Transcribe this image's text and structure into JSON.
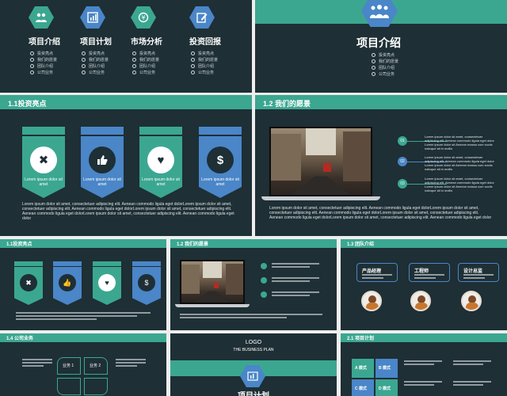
{
  "slide1": {
    "columns": [
      {
        "title": "项目介绍",
        "items": [
          "投资亮点",
          "我们的愿景",
          "团队介绍",
          "公司业务"
        ],
        "color": "#3ba791"
      },
      {
        "title": "项目计划",
        "items": [
          "投资亮点",
          "我们的愿景",
          "团队介绍",
          "公司业务"
        ],
        "color": "#4a86c8"
      },
      {
        "title": "市场分析",
        "items": [
          "投资亮点",
          "我们的愿景",
          "团队介绍",
          "公司业务"
        ],
        "color": "#3ba791"
      },
      {
        "title": "投资回报",
        "items": [
          "投资亮点",
          "我们的愿景",
          "团队介绍",
          "公司业务"
        ],
        "color": "#4a86c8"
      }
    ]
  },
  "slide2": {
    "title": "项目介绍",
    "items": [
      "投资亮点",
      "我们的愿景",
      "团队介绍",
      "公司业务"
    ]
  },
  "slide3": {
    "title": "1.1投资亮点",
    "badges": [
      {
        "icon": "tools-icon",
        "glyph": "✖",
        "caption": "Lorem ipsum dolor sit amet",
        "color": "#3ba791"
      },
      {
        "icon": "thumbs-up-icon",
        "glyph": "👍",
        "caption": "Lorem ipsum dolor sit amet",
        "color": "#4a86c8"
      },
      {
        "icon": "heart-icon",
        "glyph": "♥",
        "caption": "Lorem ipsum dolor sit amet",
        "color": "#3ba791"
      },
      {
        "icon": "dollar-icon",
        "glyph": "$",
        "caption": "Lorem ipsum dolor sit amet",
        "color": "#4a86c8"
      }
    ],
    "paragraph": "Lorem ipsum dolor sit amet, consectetuer adipiscing elit. Aenean commodo ligula eget dolorLorem ipsum dolor sit amet, consectetuer adipiscing elit. Aenean commodo ligula eget dolorLorem ipsum dolor sit amet, consectetuer adipiscing elit. Aenean commodo ligula eget dolorLorem ipsum dolor sit amet, consectetuer adipiscing elit. Aenean commodo ligula eget dolor"
  },
  "slide4": {
    "title": "1.2 我们的愿景",
    "points": [
      {
        "num": "01",
        "text": "Lorem ipsum dolor sit amet, consectetuer adipiscing elit. Aenean commodo ligula eget dolor Lorem ipsum dolor sit Aenean massa cum sociis natoque sit in mollis"
      },
      {
        "num": "02",
        "text": "Lorem ipsum dolor sit amet, consectetuer adipiscing elit. Aenean commodo ligula eget dolor Lorem ipsum dolor sit Aenean massa cum sociis natoque sit in mollis"
      },
      {
        "num": "03",
        "text": "Lorem ipsum dolor sit amet, consectetuer adipiscing elit. Aenean commodo ligula eget dolor Lorem ipsum dolor sit Aenean massa cum sociis natoque sit in mollis"
      }
    ],
    "paragraph": "Lorem ipsum dolor sit amet, consectetuer adipiscing elit. Aenean commodo ligula eget dolorLorem ipsum dolor sit amet, consectetuer adipiscing elit. Aenean commodo ligula eget dolorLorem ipsum dolor sit amet, consectetuer adipiscing elit. Aenean commodo ligula eget dolorLorem ipsum dolor sit amet, consectetuer adipiscing elit. Aenean commodo ligula eget dolor"
  },
  "slide5": {
    "title": "1.1投资亮点"
  },
  "slide6": {
    "title": "1.2 我们的愿景"
  },
  "slide7": {
    "title": "1.3 团队介绍",
    "boxes": [
      "产品经理",
      "工程师",
      "设计总监"
    ]
  },
  "slide8": {
    "title": "1.4 公司业务",
    "quads": [
      "业务 1",
      "业务 2"
    ]
  },
  "slide9": {
    "logo": "LOGO",
    "subtitle": "THE BUSINESS PLAN",
    "title": "项目计划"
  },
  "slide10": {
    "title": "2.1 项目计划",
    "tiles": [
      "A 模式",
      "B 模式",
      "C 模式",
      "D 模式"
    ]
  }
}
